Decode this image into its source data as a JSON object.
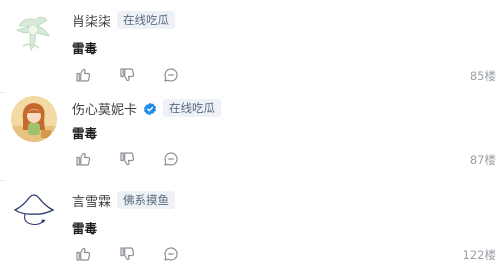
{
  "comments": [
    {
      "username": "肖柒柒",
      "badge": "在线吃瓜",
      "verified": false,
      "text": "雷毒",
      "floor": "85楼",
      "avatar_icon": "plant-character-avatar"
    },
    {
      "username": "伤心莫妮卡",
      "badge": "在线吃瓜",
      "verified": true,
      "text": "雷毒",
      "floor": "87楼",
      "avatar_icon": "girl-cartoon-avatar"
    },
    {
      "username": "言雪霖",
      "badge": "佛系摸鱼",
      "verified": false,
      "text": "雷毒",
      "floor": "122楼",
      "avatar_icon": "hat-sketch-avatar"
    }
  ],
  "icons": {
    "like": "thumbs-up-icon",
    "dislike": "thumbs-down-icon",
    "reply": "comment-icon",
    "verified": "verified-badge-icon"
  },
  "colors": {
    "badge_bg": "#eef2f7",
    "verified_blue": "#1e8ee8",
    "icon_gray": "#8a8f97"
  }
}
